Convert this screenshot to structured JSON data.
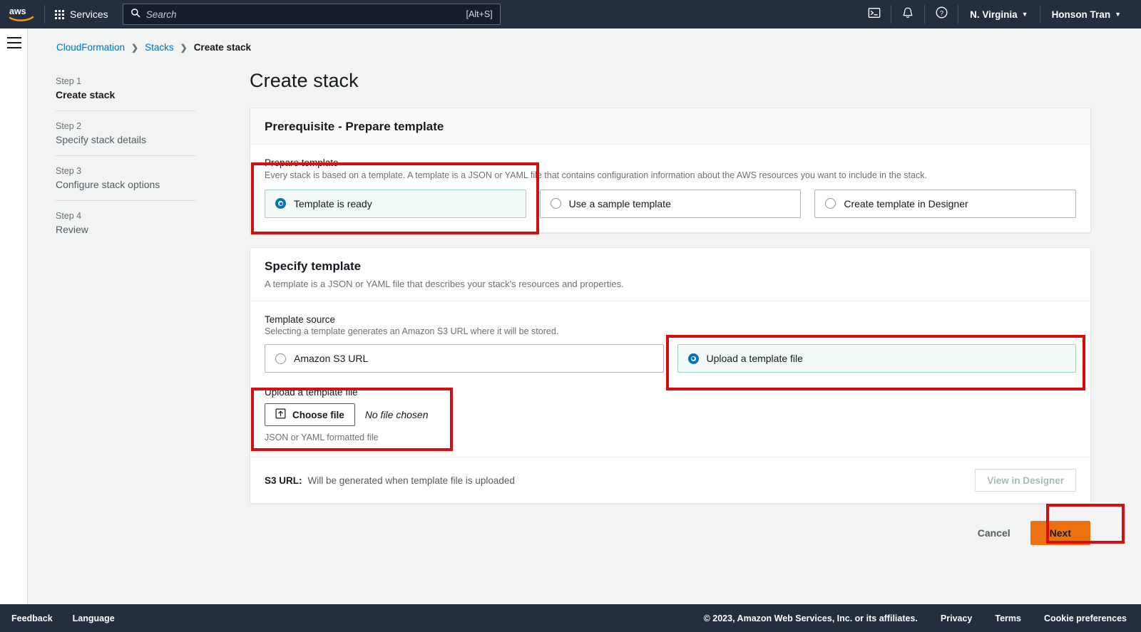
{
  "topnav": {
    "logo_alt": "aws",
    "services_label": "Services",
    "search": {
      "placeholder": "Search",
      "shortcut": "[Alt+S]"
    },
    "cloudshell_icon": "cloudshell-icon",
    "notifications_icon": "bell-icon",
    "help_icon": "question-circle-icon",
    "region_label": "N. Virginia",
    "account_label": "Honson Tran"
  },
  "breadcrumb": [
    {
      "label": "CloudFormation",
      "current": false
    },
    {
      "label": "Stacks",
      "current": false
    },
    {
      "label": "Create stack",
      "current": true
    }
  ],
  "wizard": {
    "steps": [
      {
        "num": "Step 1",
        "label": "Create stack",
        "active": true
      },
      {
        "num": "Step 2",
        "label": "Specify stack details",
        "active": false
      },
      {
        "num": "Step 3",
        "label": "Configure stack options",
        "active": false
      },
      {
        "num": "Step 4",
        "label": "Review",
        "active": false
      }
    ]
  },
  "page": {
    "title": "Create stack"
  },
  "prerequisite": {
    "card_title": "Prerequisite - Prepare template",
    "field_label": "Prepare template",
    "field_desc": "Every stack is based on a template. A template is a JSON or YAML file that contains configuration information about the AWS resources you want to include in the stack.",
    "options": [
      {
        "label": "Template is ready",
        "selected": true
      },
      {
        "label": "Use a sample template",
        "selected": false
      },
      {
        "label": "Create template in Designer",
        "selected": false
      }
    ]
  },
  "specify_template": {
    "card_title": "Specify template",
    "card_sub": "A template is a JSON or YAML file that describes your stack's resources and properties.",
    "source_label": "Template source",
    "source_desc": "Selecting a template generates an Amazon S3 URL where it will be stored.",
    "source_options": [
      {
        "label": "Amazon S3 URL",
        "selected": false
      },
      {
        "label": "Upload a template file",
        "selected": true
      }
    ],
    "upload": {
      "label": "Upload a template file",
      "button_label": "Choose file",
      "button_icon": "upload-icon",
      "file_status": "No file chosen",
      "hint": "JSON or YAML formatted file"
    },
    "s3_url_label": "S3 URL:",
    "s3_url_value": "Will be generated when template file is uploaded",
    "designer_button": "View in Designer"
  },
  "actions": {
    "cancel_label": "Cancel",
    "next_label": "Next"
  },
  "footer": {
    "feedback": "Feedback",
    "language": "Language",
    "copyright": "© 2023, Amazon Web Services, Inc. or its affiliates.",
    "privacy": "Privacy",
    "terms": "Terms",
    "cookie_preferences": "Cookie preferences"
  },
  "colors": {
    "nav_background": "#232f3e",
    "accent_link": "#0073bb",
    "primary_button": "#ec7211",
    "annotation": "#d50f0f",
    "selected_tile_bg": "#f1faf7"
  }
}
